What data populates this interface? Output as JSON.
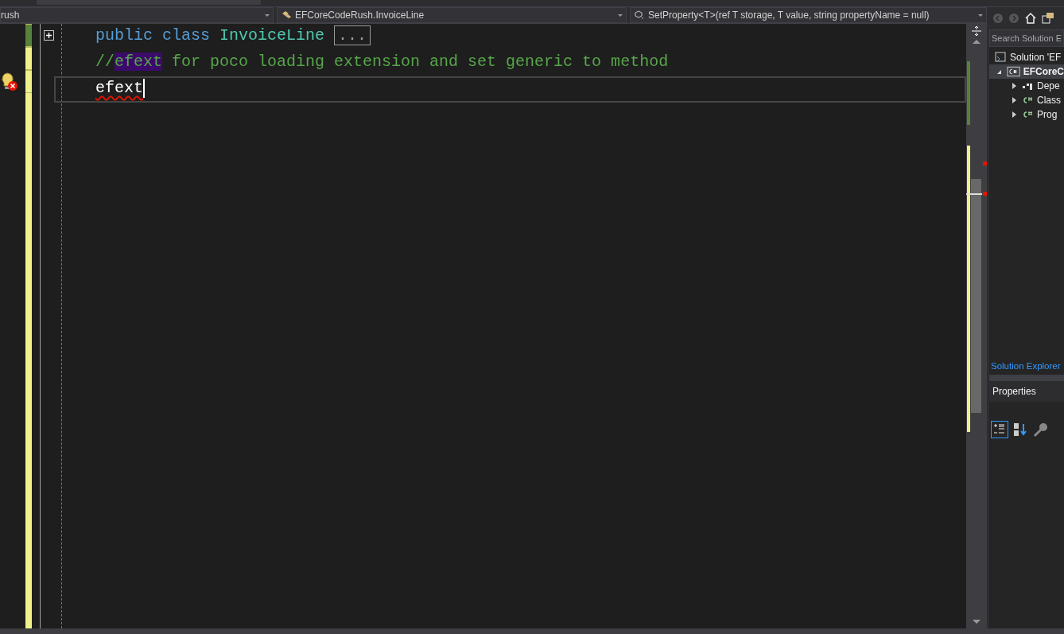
{
  "nav_bar": {
    "project": "rush",
    "type": "EFCoreCodeRush.InvoiceLine",
    "member": "SetProperty<T>(ref T storage, T value, string propertyName = null)"
  },
  "editor": {
    "lines": [
      {
        "saved": true,
        "collapsible": true,
        "error_bulb": false,
        "current": false,
        "tokens": [
          {
            "kind": "keyword",
            "text": "public"
          },
          {
            "kind": "keyword",
            "text": " class"
          },
          {
            "kind": "type",
            "text": " InvoiceLine"
          },
          {
            "kind": "collapsed",
            "text": "..."
          }
        ]
      },
      {
        "saved": false,
        "collapsible": false,
        "error_bulb": false,
        "current": false,
        "tokens": [
          {
            "kind": "comment",
            "text": "//"
          },
          {
            "kind": "highlight",
            "text": "efext"
          },
          {
            "kind": "comment",
            "text": " for poco loading extension and set generic to method"
          }
        ]
      },
      {
        "saved": false,
        "collapsible": false,
        "error_bulb": true,
        "current": true,
        "tokens": [
          {
            "kind": "error",
            "text": "efext"
          }
        ]
      }
    ]
  },
  "solution_explorer": {
    "search": {
      "placeholder": "Search Solution E"
    },
    "tree": [
      {
        "label": "Solution 'EF",
        "selected": false,
        "children": [
          {
            "label": "EFCoreC",
            "selected": true,
            "expanded": true,
            "children": [
              {
                "label": "Depe",
                "selected": false,
                "expanded": false
              },
              {
                "label": "Class",
                "selected": false,
                "expanded": false
              },
              {
                "label": "Prog",
                "selected": false,
                "expanded": false
              }
            ]
          }
        ]
      }
    ],
    "tab": "Solution Explorer"
  },
  "properties": {
    "title": "Properties"
  }
}
